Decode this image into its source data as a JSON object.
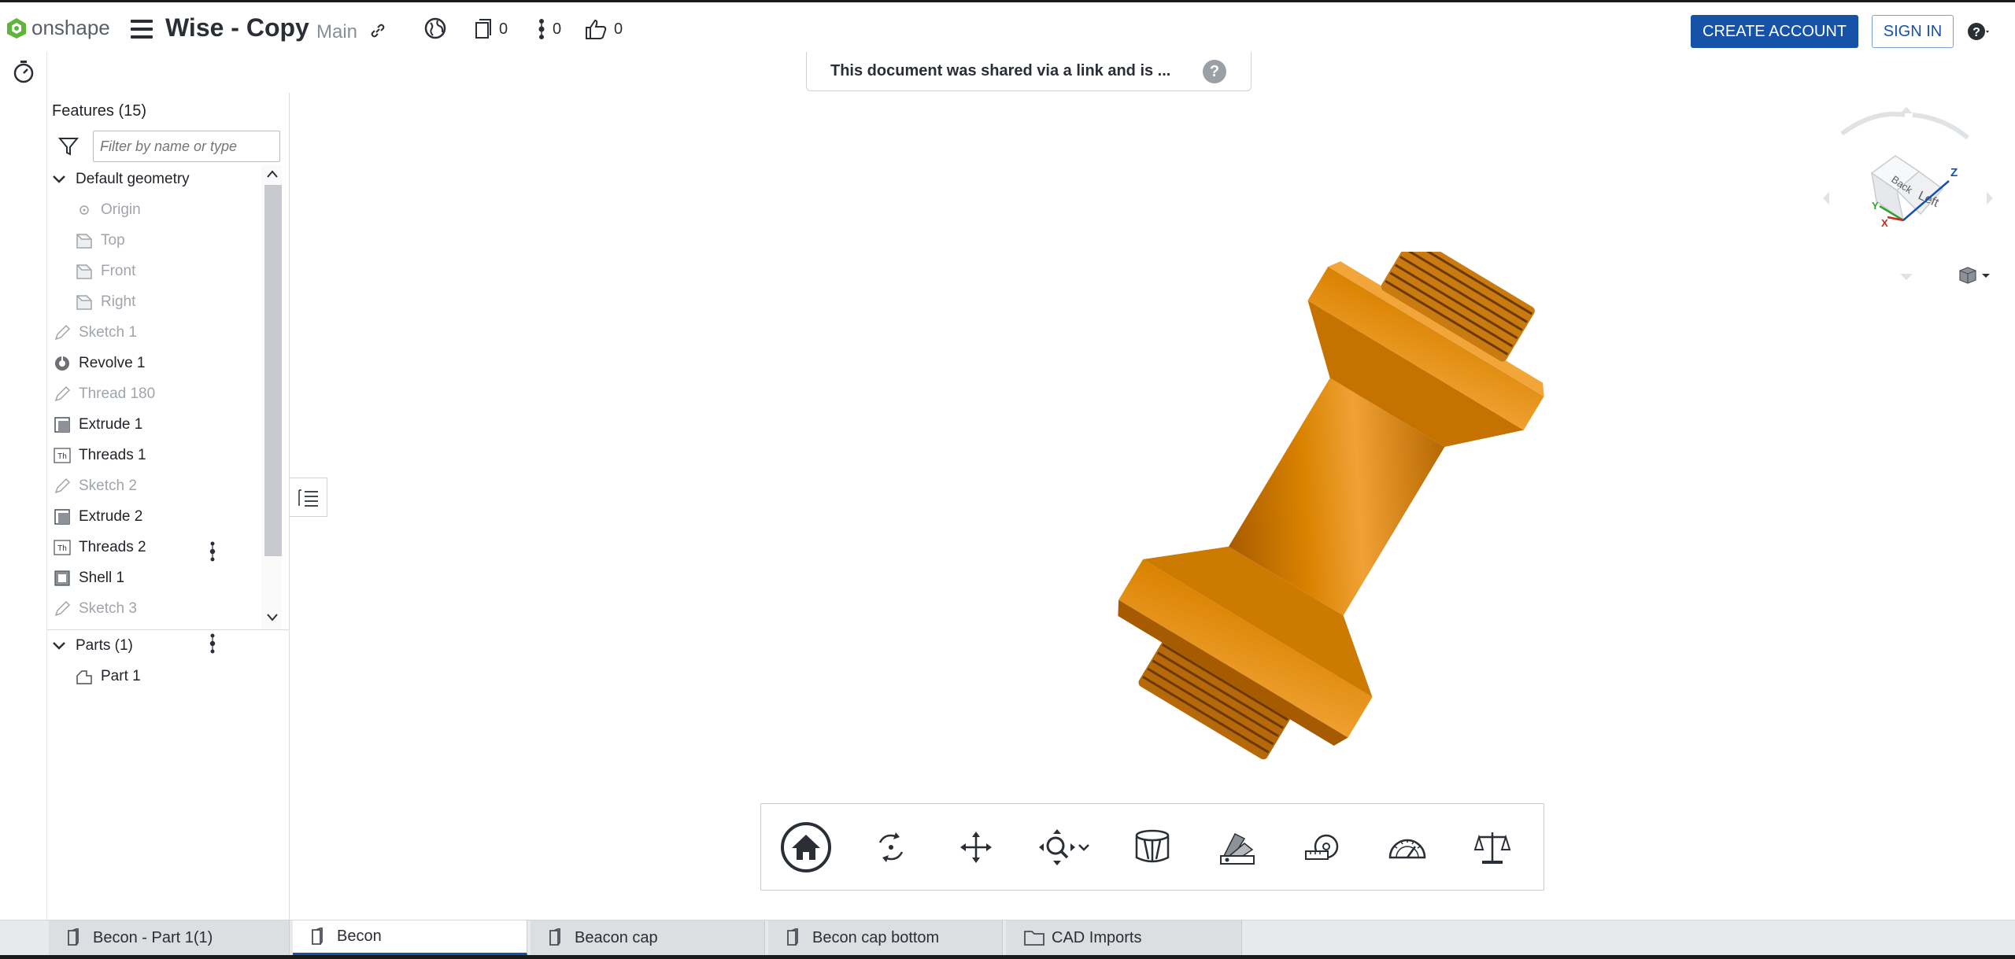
{
  "app": {
    "logo_text": "onshape",
    "doc_title": "Wise - Copy",
    "branch": "Main",
    "counts": {
      "versions": "0",
      "branches": "0",
      "likes": "0"
    },
    "create_account_label": "CREATE ACCOUNT",
    "sign_in_label": "SIGN IN"
  },
  "banner": {
    "text": "This document was shared via a link and is ..."
  },
  "features": {
    "title": "Features (15)",
    "filter_placeholder": "Filter by name or type",
    "default_geometry": "Default geometry",
    "items": {
      "origin": "Origin",
      "top": "Top",
      "front": "Front",
      "right": "Right",
      "sketch1": "Sketch 1",
      "revolve1": "Revolve 1",
      "thread180": "Thread 180",
      "extrude1": "Extrude 1",
      "threads1": "Threads 1",
      "sketch2": "Sketch 2",
      "extrude2": "Extrude 2",
      "threads2": "Threads 2",
      "shell1": "Shell 1",
      "sketch3": "Sketch 3"
    },
    "parts_title": "Parts (1)",
    "part1": "Part 1"
  },
  "viewcube": {
    "face_back": "Back",
    "face_left": "Left",
    "axis_x": "X",
    "axis_y": "Y",
    "axis_z": "Z"
  },
  "toolbar_icons": [
    "home-icon",
    "rotate-icon",
    "pan-icon",
    "zoom-icon",
    "section-view-icon",
    "appearance-icon",
    "measure-icon",
    "angle-icon",
    "mass-properties-icon"
  ],
  "tabs": [
    {
      "label": "Becon - Part 1(1)"
    },
    {
      "label": "Becon"
    },
    {
      "label": "Beacon cap"
    },
    {
      "label": "Becon cap bottom"
    },
    {
      "label": "CAD Imports"
    }
  ],
  "colors": {
    "accent": "#1552a8",
    "part": "#e08a10"
  }
}
